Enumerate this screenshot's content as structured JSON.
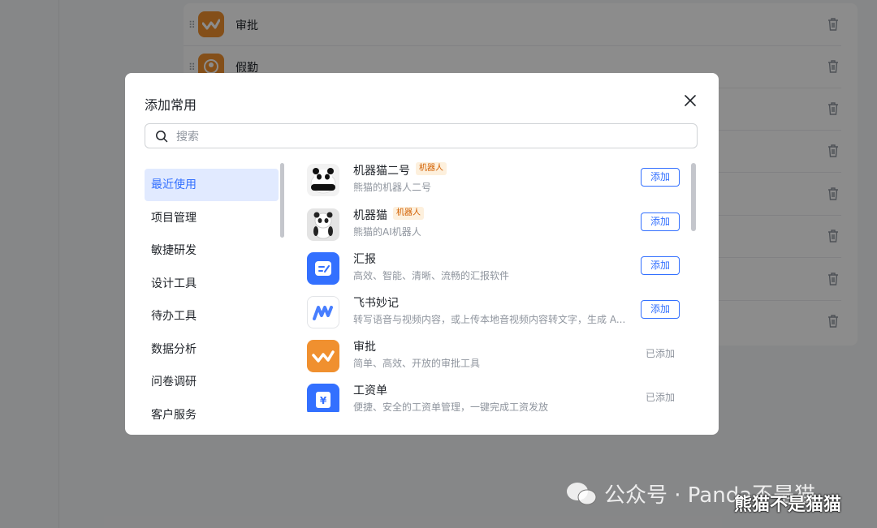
{
  "background": {
    "rows": [
      {
        "name": "审批"
      },
      {
        "name": "假勤"
      },
      {
        "name": ""
      },
      {
        "name": ""
      },
      {
        "name": ""
      },
      {
        "name": ""
      },
      {
        "name": ""
      },
      {
        "name": ""
      }
    ]
  },
  "modal": {
    "title": "添加常用",
    "search_placeholder": "搜索",
    "categories": [
      "最近使用",
      "项目管理",
      "敏捷研发",
      "设计工具",
      "待办工具",
      "数据分析",
      "问卷调研",
      "客户服务"
    ],
    "add_label": "添加",
    "added_label": "已添加",
    "apps": [
      {
        "name": "机器猫二号",
        "tag": "机器人",
        "desc": "熊猫的机器人二号",
        "status": "add",
        "icon": "panda-robot-icon"
      },
      {
        "name": "机器猫",
        "tag": "机器人",
        "desc": "熊猫的AI机器人",
        "status": "add",
        "icon": "panda-robot-icon"
      },
      {
        "name": "汇报",
        "tag": "",
        "desc": "高效、智能、清晰、流畅的汇报软件",
        "status": "add",
        "icon": "report-icon"
      },
      {
        "name": "飞书妙记",
        "tag": "",
        "desc": "转写语音与视频内容，或上传本地音视频内容转文字，生成 A...",
        "status": "add",
        "icon": "minutes-icon"
      },
      {
        "name": "审批",
        "tag": "",
        "desc": "简单、高效、开放的审批工具",
        "status": "added",
        "icon": "approval-icon"
      },
      {
        "name": "工资单",
        "tag": "",
        "desc": "便捷、安全的工资单管理，一键完成工资发放",
        "status": "added",
        "icon": "payroll-icon"
      }
    ]
  },
  "watermark": {
    "text": "公众号 · Panda不是猫",
    "text2": "熊猫不是猫猫"
  },
  "colors": {
    "accent": "#3370ff",
    "tag_text": "#d25f00",
    "approval_orange": "#f0902f"
  }
}
